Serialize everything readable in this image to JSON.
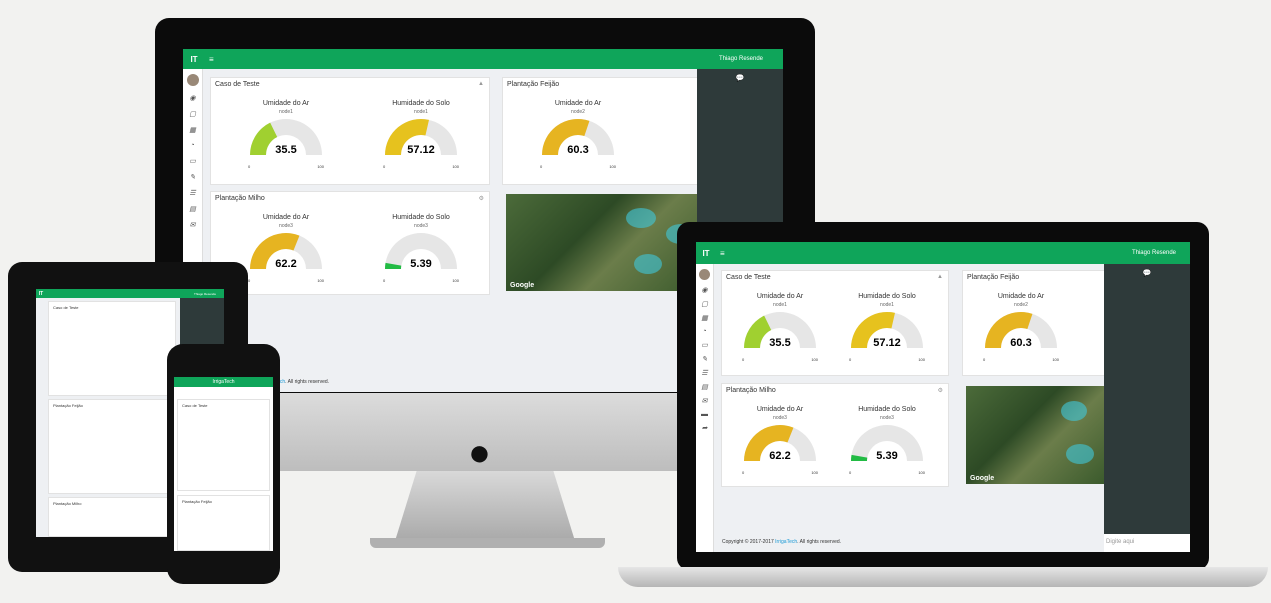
{
  "brand": {
    "logo": "IT",
    "mobile_title": "IrrigaTech"
  },
  "user": {
    "name": "Thiago Resende"
  },
  "panels": {
    "p1": {
      "title": "Caso de Teste"
    },
    "p2": {
      "title": "Plantação Feijão"
    },
    "p3": {
      "title": "Plantação Milho"
    }
  },
  "gauges": {
    "g1": {
      "label": "Umidade do Ar",
      "node": "node1",
      "value": "35.5",
      "min": "0",
      "max": "100",
      "fill": 0.355,
      "color": "#a0d030"
    },
    "g2": {
      "label": "Humidade do Solo",
      "node": "node1",
      "value": "57.12",
      "min": "0",
      "max": "100",
      "fill": 0.5712,
      "color": "#e6c21e"
    },
    "g3": {
      "label": "Umidade do Ar",
      "node": "node2",
      "value": "60.3",
      "min": "0",
      "max": "100",
      "fill": 0.603,
      "color": "#e6b421"
    },
    "g4": {
      "label": "Umidade do Ar",
      "node": "node3",
      "value": "62.2",
      "min": "0",
      "max": "100",
      "fill": 0.622,
      "color": "#e6b421"
    },
    "g5": {
      "label": "Humidade do Solo",
      "node": "node3",
      "value": "5.39",
      "min": "0",
      "max": "100",
      "fill": 0.0539,
      "color": "#22bb44"
    }
  },
  "map": {
    "label": "Google"
  },
  "footer": {
    "prefix": "Copyright © 2017-2017",
    "brand": "IrrigaTech",
    "suffix": ". All rights reserved."
  },
  "chat": {
    "placeholder": "Digite aqui"
  }
}
